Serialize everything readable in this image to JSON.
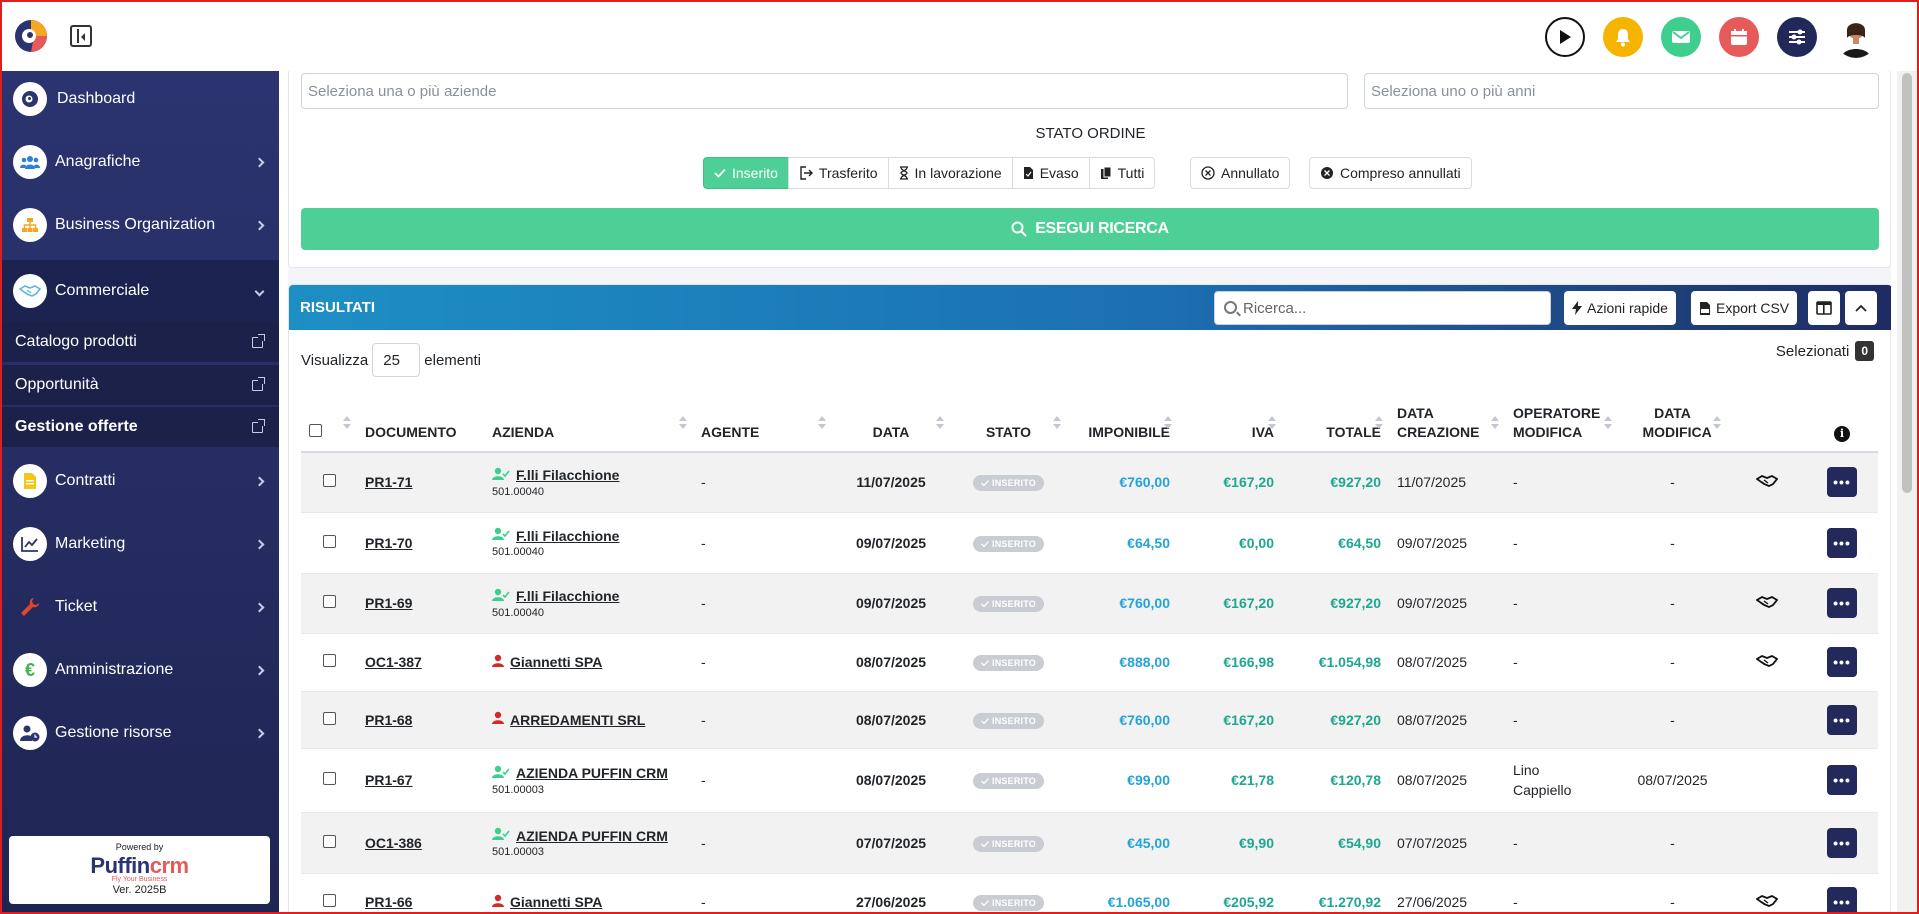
{
  "sidebar": {
    "items": [
      {
        "label": "Dashboard"
      },
      {
        "label": "Anagrafiche"
      },
      {
        "label": "Business Organization"
      },
      {
        "label": "Commerciale"
      },
      {
        "label": "Contratti"
      },
      {
        "label": "Marketing"
      },
      {
        "label": "Ticket"
      },
      {
        "label": "Amministrazione"
      },
      {
        "label": "Gestione risorse"
      }
    ],
    "sub_items": [
      {
        "label": "Catalogo prodotti"
      },
      {
        "label": "Opportunità"
      },
      {
        "label": "Gestione offerte"
      }
    ],
    "powered_by": "Powered by",
    "brand_a": "Puffin",
    "brand_b": "crm",
    "tagline": "Fly Your Business",
    "version": "Ver. 2025B"
  },
  "filters": {
    "aziende_placeholder": "Seleziona una o più aziende",
    "anni_placeholder": "Seleziona uno o più anni",
    "stato_title": "STATO ORDINE",
    "group": [
      "Inserito",
      "Trasferito",
      "In lavorazione",
      "Evaso",
      "Tutti"
    ],
    "annullato": "Annullato",
    "compreso": "Compreso annullati",
    "search_label": "ESEGUI RICERCA"
  },
  "results": {
    "title": "RISULTATI",
    "search_placeholder": "Ricerca...",
    "azioni": "Azioni rapide",
    "export": "Export CSV",
    "vis_prefix": "Visualizza",
    "vis_value": "25",
    "vis_suffix": "elementi",
    "selezionati": "Selezionati",
    "sel_count": "0",
    "columns": [
      "DOCUMENTO",
      "AZIENDA",
      "AGENTE",
      "DATA",
      "STATO",
      "IMPONIBILE",
      "IVA",
      "TOTALE",
      "DATA CREAZIONE",
      "OPERATORE MODIFICA",
      "DATA MODIFICA"
    ],
    "rows": [
      {
        "doc": "PR1-71",
        "az": "F.lli Filacchione",
        "code": "501.00040",
        "agente": "-",
        "data": "11/07/2025",
        "stato": "INSERITO",
        "imp": "€760,00",
        "iva": "€167,20",
        "tot": "€927,20",
        "crea": "11/07/2025",
        "op": "-",
        "mod": "-"
      },
      {
        "doc": "PR1-70",
        "az": "F.lli Filacchione",
        "code": "501.00040",
        "agente": "-",
        "data": "09/07/2025",
        "stato": "INSERITO",
        "imp": "€64,50",
        "iva": "€0,00",
        "tot": "€64,50",
        "crea": "09/07/2025",
        "op": "-",
        "mod": "-"
      },
      {
        "doc": "PR1-69",
        "az": "F.lli Filacchione",
        "code": "501.00040",
        "agente": "-",
        "data": "09/07/2025",
        "stato": "INSERITO",
        "imp": "€760,00",
        "iva": "€167,20",
        "tot": "€927,20",
        "crea": "09/07/2025",
        "op": "-",
        "mod": "-"
      },
      {
        "doc": "OC1-387",
        "az": "Giannetti SPA",
        "code": "",
        "agente": "-",
        "data": "08/07/2025",
        "stato": "INSERITO",
        "imp": "€888,00",
        "iva": "€166,98",
        "tot": "€1.054,98",
        "crea": "08/07/2025",
        "op": "-",
        "mod": "-"
      },
      {
        "doc": "PR1-68",
        "az": "ARREDAMENTI SRL",
        "code": "",
        "agente": "-",
        "data": "08/07/2025",
        "stato": "INSERITO",
        "imp": "€760,00",
        "iva": "€167,20",
        "tot": "€927,20",
        "crea": "08/07/2025",
        "op": "-",
        "mod": "-"
      },
      {
        "doc": "PR1-67",
        "az": "AZIENDA PUFFIN CRM",
        "code": "501.00003",
        "agente": "-",
        "data": "08/07/2025",
        "stato": "INSERITO",
        "imp": "€99,00",
        "iva": "€21,78",
        "tot": "€120,78",
        "crea": "08/07/2025",
        "op": "Lino Cappiello",
        "mod": "08/07/2025"
      },
      {
        "doc": "OC1-386",
        "az": "AZIENDA PUFFIN CRM",
        "code": "501.00003",
        "agente": "-",
        "data": "07/07/2025",
        "stato": "INSERITO",
        "imp": "€45,00",
        "iva": "€9,90",
        "tot": "€54,90",
        "crea": "07/07/2025",
        "op": "-",
        "mod": "-"
      },
      {
        "doc": "PR1-66",
        "az": "Giannetti SPA",
        "code": "",
        "agente": "-",
        "data": "27/06/2025",
        "stato": "INSERITO",
        "imp": "€1.065,00",
        "iva": "€205,92",
        "tot": "€1.270,92",
        "crea": "27/06/2025",
        "op": "-",
        "mod": "-"
      }
    ]
  },
  "colors": {
    "accent_green": "#4ecf95",
    "navy": "#24295c",
    "blue": "#24a3d6",
    "teal": "#1fa68e"
  },
  "icons": {
    "row_icons": [
      "user-check-icon",
      "user-check-icon",
      "user-check-icon",
      "user-icon",
      "user-icon",
      "user-check-icon",
      "user-check-icon",
      "user-icon"
    ],
    "handshake_rows": [
      0,
      2,
      3,
      7
    ]
  }
}
